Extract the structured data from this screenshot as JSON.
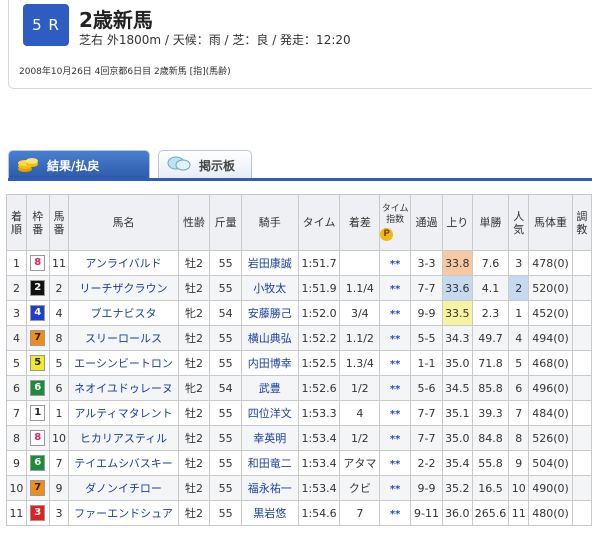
{
  "race": {
    "number": "5 R",
    "title": "2歳新馬",
    "conditions": "芝右 外1800m / 天候：雨 / 芝：良 / 発走：12:20",
    "date_line": "2008年10月26日 4回京都6日目 2歳新馬 [指](馬齢)"
  },
  "tabs": [
    {
      "label": "結果/払戻",
      "icon": "coins-icon",
      "active": true
    },
    {
      "label": "掲示板",
      "icon": "chat-bubble-icon",
      "active": false
    }
  ],
  "table": {
    "headers": [
      "着順",
      "枠番",
      "馬番",
      "馬名",
      "性齢",
      "斤量",
      "騎手",
      "タイム",
      "着差",
      "タイム指数",
      "通過",
      "上り",
      "単勝",
      "人気",
      "馬体重",
      "調教"
    ],
    "time_index_badge": "P",
    "rows": [
      {
        "pos": "1",
        "frame": "8",
        "frame_bg": "#ffffff",
        "frame_fg": "#e0245e",
        "num": "11",
        "name": "アンライバルド",
        "sex_age": "牡2",
        "weight": "55",
        "jockey": "岩田康誠",
        "time": "1:51.7",
        "margin": "",
        "idx": "**",
        "pass": "3-3",
        "last": "33.8",
        "last_rank": 1,
        "odds": "7.6",
        "pop": "3",
        "pop_rank": 0,
        "body": "478(0)"
      },
      {
        "pos": "2",
        "frame": "2",
        "frame_bg": "#111111",
        "frame_fg": "#ffffff",
        "num": "2",
        "name": "リーチザクラウン",
        "sex_age": "牡2",
        "weight": "55",
        "jockey": "小牧太",
        "time": "1:51.9",
        "margin": "1.1/4",
        "idx": "**",
        "pass": "7-7",
        "last": "33.6",
        "last_rank": 2,
        "odds": "4.1",
        "pop": "2",
        "pop_rank": 2,
        "body": "520(0)"
      },
      {
        "pos": "3",
        "frame": "4",
        "frame_bg": "#1f3fcf",
        "frame_fg": "#ffffff",
        "num": "4",
        "name": "ブエナビスタ",
        "sex_age": "牝2",
        "weight": "54",
        "jockey": "安藤勝己",
        "time": "1:52.0",
        "margin": "3/4",
        "idx": "**",
        "pass": "9-9",
        "last": "33.5",
        "last_rank": 3,
        "odds": "2.3",
        "pop": "1",
        "pop_rank": 0,
        "body": "452(0)"
      },
      {
        "pos": "4",
        "frame": "7",
        "frame_bg": "#f08c19",
        "frame_fg": "#222222",
        "num": "8",
        "name": "スリーロールス",
        "sex_age": "牡2",
        "weight": "55",
        "jockey": "横山典弘",
        "time": "1:52.2",
        "margin": "1.1/2",
        "idx": "**",
        "pass": "5-5",
        "last": "34.3",
        "last_rank": 0,
        "odds": "49.7",
        "pop": "4",
        "pop_rank": 0,
        "body": "494(0)"
      },
      {
        "pos": "5",
        "frame": "5",
        "frame_bg": "#f2ea2a",
        "frame_fg": "#222222",
        "num": "5",
        "name": "エーシンビートロン",
        "sex_age": "牡2",
        "weight": "55",
        "jockey": "内田博幸",
        "time": "1:52.5",
        "margin": "1.3/4",
        "idx": "**",
        "pass": "1-1",
        "last": "35.0",
        "last_rank": 0,
        "odds": "71.8",
        "pop": "5",
        "pop_rank": 0,
        "body": "468(0)"
      },
      {
        "pos": "6",
        "frame": "6",
        "frame_bg": "#1a8c3a",
        "frame_fg": "#ffffff",
        "num": "6",
        "name": "ネオイユドゥレーヌ",
        "sex_age": "牝2",
        "weight": "54",
        "jockey": "武豊",
        "time": "1:52.6",
        "margin": "1/2",
        "idx": "**",
        "pass": "5-6",
        "last": "34.5",
        "last_rank": 0,
        "odds": "85.8",
        "pop": "6",
        "pop_rank": 0,
        "body": "496(0)"
      },
      {
        "pos": "7",
        "frame": "1",
        "frame_bg": "#ffffff",
        "frame_fg": "#222222",
        "num": "1",
        "name": "アルティマタレント",
        "sex_age": "牡2",
        "weight": "55",
        "jockey": "四位洋文",
        "time": "1:53.3",
        "margin": "4",
        "idx": "**",
        "pass": "7-7",
        "last": "35.1",
        "last_rank": 0,
        "odds": "39.3",
        "pop": "7",
        "pop_rank": 0,
        "body": "484(0)"
      },
      {
        "pos": "8",
        "frame": "8",
        "frame_bg": "#ffffff",
        "frame_fg": "#e0245e",
        "num": "10",
        "name": "ヒカリアスティル",
        "sex_age": "牡2",
        "weight": "55",
        "jockey": "幸英明",
        "time": "1:53.4",
        "margin": "1/2",
        "idx": "**",
        "pass": "7-7",
        "last": "35.0",
        "last_rank": 0,
        "odds": "84.8",
        "pop": "8",
        "pop_rank": 0,
        "body": "526(0)"
      },
      {
        "pos": "9",
        "frame": "6",
        "frame_bg": "#1a8c3a",
        "frame_fg": "#ffffff",
        "num": "7",
        "name": "テイエムシバスキー",
        "sex_age": "牡2",
        "weight": "55",
        "jockey": "和田竜二",
        "time": "1:53.4",
        "margin": "アタマ",
        "idx": "**",
        "pass": "2-2",
        "last": "35.4",
        "last_rank": 0,
        "odds": "55.8",
        "pop": "9",
        "pop_rank": 0,
        "body": "504(0)"
      },
      {
        "pos": "10",
        "frame": "7",
        "frame_bg": "#f08c19",
        "frame_fg": "#222222",
        "num": "9",
        "name": "ダノンイチロー",
        "sex_age": "牡2",
        "weight": "55",
        "jockey": "福永祐一",
        "time": "1:53.4",
        "margin": "クビ",
        "idx": "**",
        "pass": "9-9",
        "last": "35.2",
        "last_rank": 0,
        "odds": "16.5",
        "pop": "10",
        "pop_rank": 0,
        "body": "490(0)"
      },
      {
        "pos": "11",
        "frame": "3",
        "frame_bg": "#e02020",
        "frame_fg": "#ffffff",
        "num": "3",
        "name": "ファーエンドシュア",
        "sex_age": "牡2",
        "weight": "55",
        "jockey": "黒岩悠",
        "time": "1:54.6",
        "margin": "7",
        "idx": "**",
        "pass": "9-11",
        "last": "36.0",
        "last_rank": 0,
        "odds": "265.6",
        "pop": "11",
        "pop_rank": 0,
        "body": "480(0)"
      }
    ]
  }
}
